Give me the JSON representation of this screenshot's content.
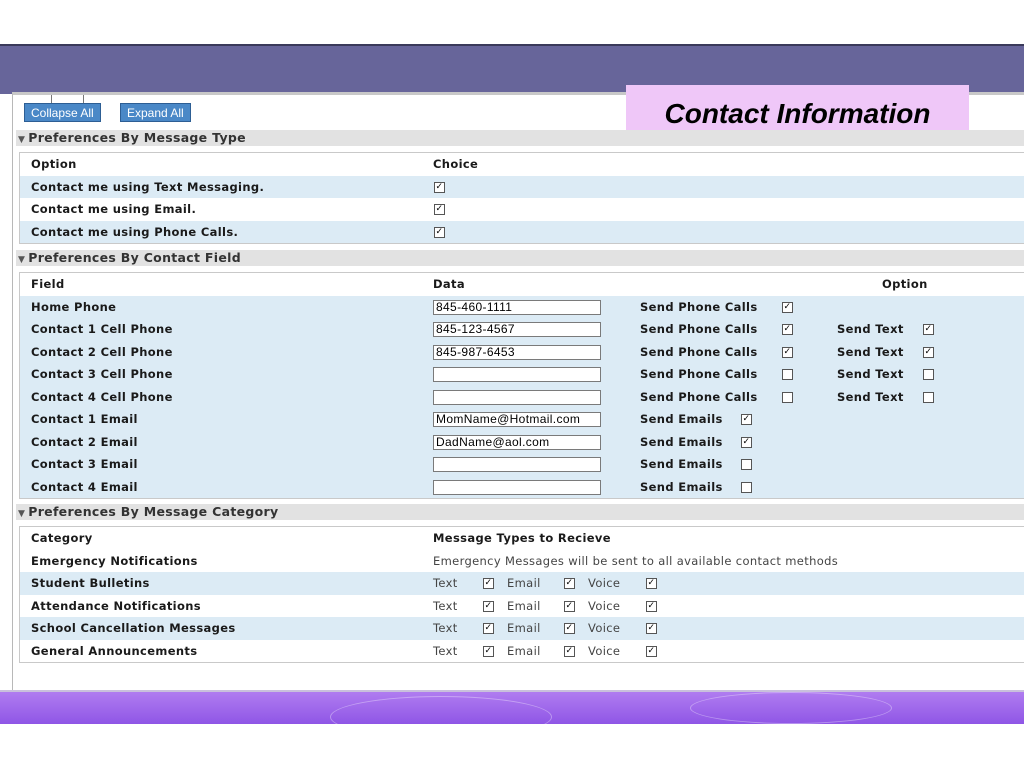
{
  "slide": {
    "title": "Contact Information"
  },
  "toolbar": {
    "collapse_label": "Collapse All",
    "expand_label": "Expand All"
  },
  "message_type": {
    "header": "Preferences By Message Type",
    "col_option": "Option",
    "col_choice": "Choice",
    "rows": [
      {
        "label": "Contact me using Text Messaging.",
        "checked": true
      },
      {
        "label": "Contact me using Email.",
        "checked": true
      },
      {
        "label": "Contact me using Phone Calls.",
        "checked": true
      }
    ]
  },
  "contact_field": {
    "header": "Preferences By Contact Field",
    "col_field": "Field",
    "col_data": "Data",
    "col_option": "Option",
    "rows": [
      {
        "label": "Home Phone",
        "value": "845-460-1111",
        "opt1_label": "Send Phone Calls",
        "opt1_checked": true,
        "opt2_label": "",
        "opt2_checked": false
      },
      {
        "label": "Contact 1 Cell Phone",
        "value": "845-123-4567",
        "opt1_label": "Send Phone Calls",
        "opt1_checked": true,
        "opt2_label": "Send Text",
        "opt2_checked": true
      },
      {
        "label": "Contact 2 Cell Phone",
        "value": "845-987-6453",
        "opt1_label": "Send Phone Calls",
        "opt1_checked": true,
        "opt2_label": "Send Text",
        "opt2_checked": true
      },
      {
        "label": "Contact 3 Cell Phone",
        "value": "",
        "opt1_label": "Send Phone Calls",
        "opt1_checked": false,
        "opt2_label": "Send Text",
        "opt2_checked": false
      },
      {
        "label": "Contact 4 Cell Phone",
        "value": "",
        "opt1_label": "Send Phone Calls",
        "opt1_checked": false,
        "opt2_label": "Send Text",
        "opt2_checked": false
      },
      {
        "label": "Contact 1 Email",
        "value": "MomName@Hotmail.com",
        "opt1_label": "Send Emails",
        "opt1_checked": true,
        "opt2_label": "",
        "opt2_checked": false
      },
      {
        "label": "Contact 2 Email",
        "value": "DadName@aol.com",
        "opt1_label": "Send Emails",
        "opt1_checked": true,
        "opt2_label": "",
        "opt2_checked": false
      },
      {
        "label": "Contact 3 Email",
        "value": "",
        "opt1_label": "Send Emails",
        "opt1_checked": false,
        "opt2_label": "",
        "opt2_checked": false
      },
      {
        "label": "Contact 4 Email",
        "value": "",
        "opt1_label": "Send Emails",
        "opt1_checked": false,
        "opt2_label": "",
        "opt2_checked": false
      }
    ]
  },
  "message_category": {
    "header": "Preferences By Message Category",
    "col_category": "Category",
    "col_types": "Message Types to Recieve",
    "emergency": {
      "label": "Emergency Notifications",
      "note": "Emergency Messages will be sent to all available contact methods"
    },
    "type_labels": {
      "text": "Text",
      "email": "Email",
      "voice": "Voice"
    },
    "rows": [
      {
        "label": "Student Bulletins",
        "text": true,
        "email": true,
        "voice": true
      },
      {
        "label": "Attendance Notifications",
        "text": true,
        "email": true,
        "voice": true
      },
      {
        "label": "School Cancellation Messages",
        "text": true,
        "email": true,
        "voice": true
      },
      {
        "label": "General Announcements",
        "text": true,
        "email": true,
        "voice": true
      }
    ]
  },
  "colors": {
    "top_band": "#67659a",
    "bottom_band": "#9b63ea",
    "title_box": "#efc7f8",
    "row_alt": "#dcebf5",
    "section_header": "#e2e2e2",
    "button": "#4a88c7"
  },
  "icons": {
    "expand_collapse": "triangle-down-icon",
    "check": "checkmark-icon"
  }
}
